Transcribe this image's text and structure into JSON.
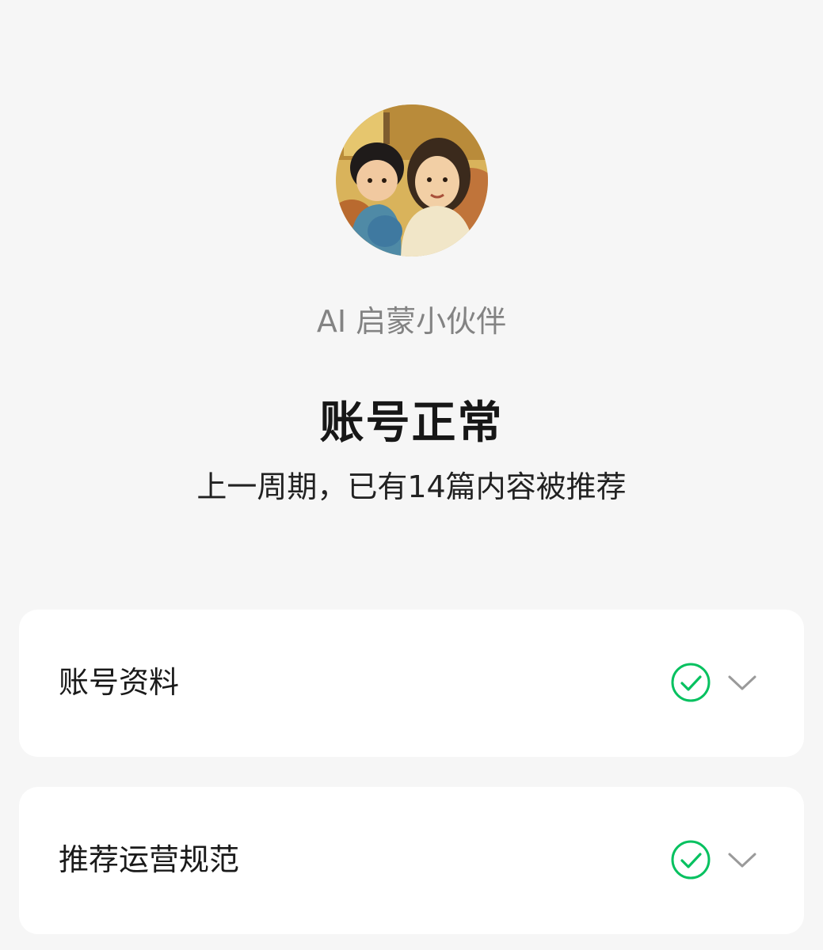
{
  "profile": {
    "avatar_icon": "avatar-illustration-mother-and-child",
    "name": "AI 启蒙小伙伴"
  },
  "status": {
    "title": "账号正常",
    "subtitle": "上一周期，已有14篇内容被推荐"
  },
  "checks": [
    {
      "label": "账号资料",
      "status_icon": "check-circle-icon",
      "expand_icon": "chevron-down-icon"
    },
    {
      "label": "推荐运营规范",
      "status_icon": "check-circle-icon",
      "expand_icon": "chevron-down-icon"
    }
  ],
  "colors": {
    "background": "#f6f6f6",
    "card": "#ffffff",
    "success_green": "#07c160",
    "muted_text": "#838383",
    "primary_text": "#171717",
    "chevron": "#9a9a9a"
  }
}
